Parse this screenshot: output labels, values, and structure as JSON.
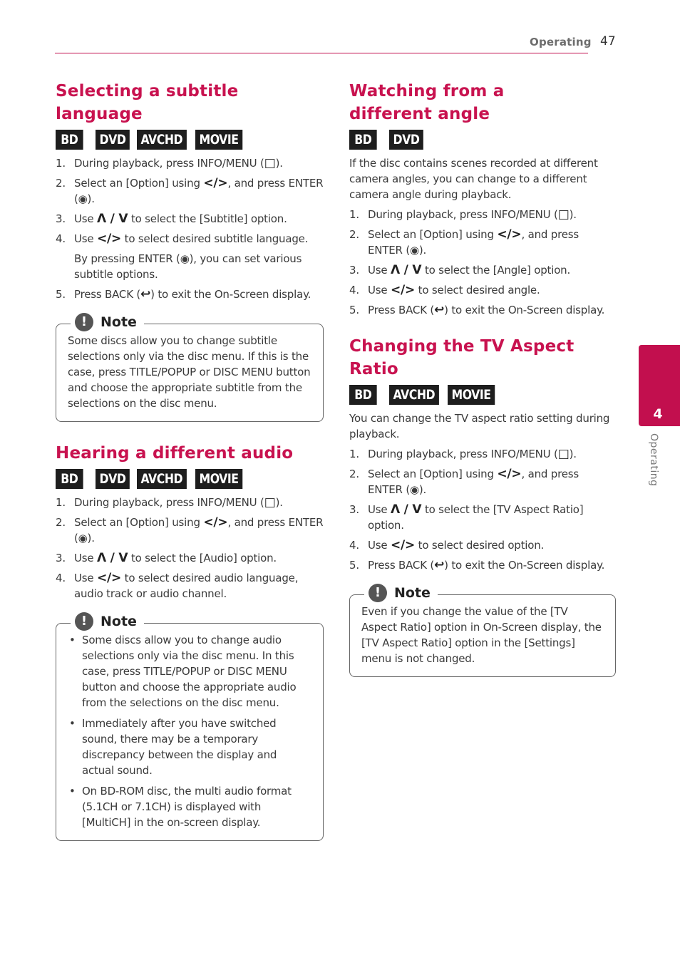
{
  "header": {
    "section": "Operating",
    "page_number": "47"
  },
  "side_tab": {
    "chapter": "4",
    "label": "Operating"
  },
  "colors": {
    "accent": "#c20f4e",
    "badge_bg": "#1e1e1e"
  },
  "sections": {
    "subtitle": {
      "title": "Selecting a subtitle language",
      "badges": [
        "BD",
        "DVD",
        "AVCHD",
        "MOVIE"
      ],
      "steps": [
        {
          "num": "1.",
          "text": "During playback, press INFO/MENU (",
          "icon": "menu-icon",
          "icon_glyph": "□",
          "after": ")."
        },
        {
          "num": "2.",
          "text": "Select an [Option] using ",
          "icon": "left-right-icon",
          "icon_glyph": "</>",
          "after": ", and press ENTER (◉)."
        },
        {
          "num": "3.",
          "text": "Use ",
          "icon": "up-down-icon",
          "icon_glyph": "Λ / V",
          "after": " to select the [Subtitle] option."
        },
        {
          "num": "4.",
          "text": "Use ",
          "icon": "left-right-icon",
          "icon_glyph": "</>",
          "after": " to select desired subtitle language.",
          "sub": "By pressing ENTER (◉), you can set various subtitle options."
        },
        {
          "num": "5.",
          "text": "Press BACK (",
          "icon": "back-icon",
          "icon_glyph": "↩",
          "after": ") to exit the On-Screen display."
        }
      ],
      "note": {
        "title": "Note",
        "text": "Some discs allow you to change subtitle selections only via the disc menu. If this is the case, press TITLE/POPUP or DISC MENU button and choose the appropriate subtitle from the selections on the disc menu."
      }
    },
    "audio": {
      "title": "Hearing a different audio",
      "badges": [
        "BD",
        "DVD",
        "AVCHD",
        "MOVIE"
      ],
      "steps": [
        {
          "num": "1.",
          "text": "During playback, press INFO/MENU (",
          "icon": "menu-icon",
          "icon_glyph": "□",
          "after": ")."
        },
        {
          "num": "2.",
          "text": "Select an [Option] using ",
          "icon": "left-right-icon",
          "icon_glyph": "</>",
          "after": ", and press ENTER (◉)."
        },
        {
          "num": "3.",
          "text": "Use ",
          "icon": "up-down-icon",
          "icon_glyph": "Λ / V",
          "after": " to select the [Audio] option."
        },
        {
          "num": "4.",
          "text": "Use ",
          "icon": "left-right-icon",
          "icon_glyph": "</>",
          "after": " to select desired audio language, audio track or audio channel."
        }
      ],
      "note": {
        "title": "Note",
        "bullets": [
          "Some discs allow you to change audio selections only via the disc menu. In this case, press TITLE/POPUP or DISC MENU button and choose the appropriate audio from the selections on the disc menu.",
          "Immediately after you have switched sound, there may be a temporary discrepancy between the display and actual sound.",
          "On BD-ROM disc, the multi audio format (5.1CH or 7.1CH) is displayed with [MultiCH] in the on-screen display."
        ]
      }
    },
    "angle": {
      "title": "Watching from a different angle",
      "badges": [
        "BD",
        "DVD"
      ],
      "intro": "If the disc contains scenes recorded at different camera angles, you can change to a different camera angle during playback.",
      "steps": [
        {
          "num": "1.",
          "text": "During playback, press INFO/MENU (",
          "icon": "menu-icon",
          "icon_glyph": "□",
          "after": ")."
        },
        {
          "num": "2.",
          "text": "Select an [Option] using ",
          "icon": "left-right-icon",
          "icon_glyph": "</>",
          "after": ", and press ENTER (◉)."
        },
        {
          "num": "3.",
          "text": "Use ",
          "icon": "up-down-icon",
          "icon_glyph": "Λ / V",
          "after": " to select the [Angle] option."
        },
        {
          "num": "4.",
          "text": "Use ",
          "icon": "left-right-icon",
          "icon_glyph": "</>",
          "after": " to select desired angle."
        },
        {
          "num": "5.",
          "text": "Press BACK (",
          "icon": "back-icon",
          "icon_glyph": "↩",
          "after": ") to exit the On-Screen display."
        }
      ]
    },
    "aspect": {
      "title": "Changing the TV Aspect Ratio",
      "badges": [
        "BD",
        "AVCHD",
        "MOVIE"
      ],
      "intro": "You can change the TV aspect ratio setting during playback.",
      "steps": [
        {
          "num": "1.",
          "text": "During playback, press INFO/MENU (",
          "icon": "menu-icon",
          "icon_glyph": "□",
          "after": ")."
        },
        {
          "num": "2.",
          "text": "Select an [Option] using ",
          "icon": "left-right-icon",
          "icon_glyph": "</>",
          "after": ", and press ENTER (◉)."
        },
        {
          "num": "3.",
          "text": "Use ",
          "icon": "up-down-icon",
          "icon_glyph": "Λ / V",
          "after": " to select the [TV Aspect Ratio] option."
        },
        {
          "num": "4.",
          "text": "Use ",
          "icon": "left-right-icon",
          "icon_glyph": "</>",
          "after": " to select desired option."
        },
        {
          "num": "5.",
          "text": "Press BACK (",
          "icon": "back-icon",
          "icon_glyph": "↩",
          "after": ") to exit the On-Screen display."
        }
      ],
      "note": {
        "title": "Note",
        "text": "Even if you change the value of the [TV Aspect Ratio] option in On-Screen display, the [TV Aspect Ratio] option in the [Settings] menu is not changed."
      }
    }
  }
}
